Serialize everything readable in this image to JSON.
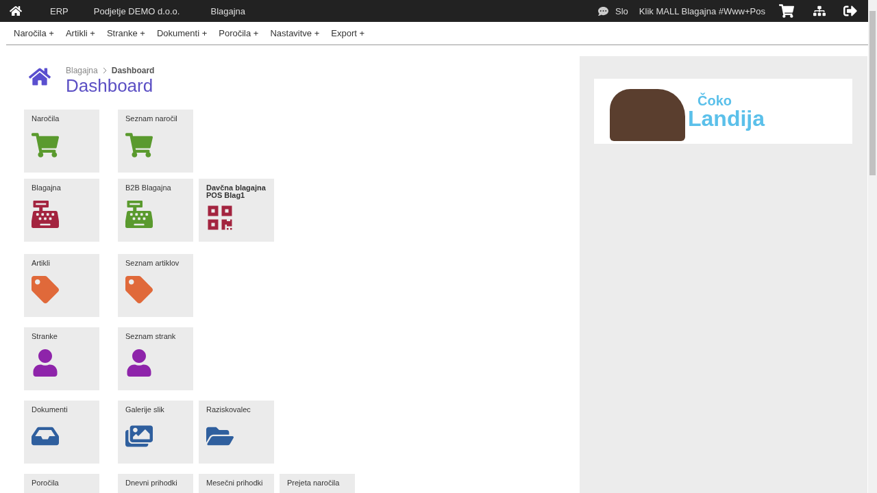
{
  "top_bar": {
    "items": [
      "ERP",
      "Podjetje DEMO d.o.o.",
      "Blagajna"
    ],
    "language": "Slo",
    "store": "Klik MALL Blagajna #Www+Pos"
  },
  "menu": [
    "Naročila +",
    "Artikli +",
    "Stranke +",
    "Dokumenti +",
    "Poročila +",
    "Nastavitve +",
    "Export +"
  ],
  "breadcrumb": {
    "parent": "Blagajna",
    "current": "Dashboard"
  },
  "title": "Dashboard",
  "groups": [
    {
      "rows": [
        [
          {
            "label": "Naročila",
            "kind": "cart",
            "color": "#5a9a2e",
            "bold": false
          },
          {
            "label": "Seznam naročil",
            "kind": "cart",
            "color": "#5a9a2e",
            "bold": false
          }
        ],
        [
          {
            "label": "Blagajna",
            "kind": "register",
            "color": "#a3243f",
            "bold": false
          },
          {
            "label": "B2B Blagajna",
            "kind": "register",
            "color": "#5a9a2e",
            "bold": false
          },
          {
            "label": "Davčna blagajna POS Blag1",
            "kind": "qr",
            "color": "#a3243f",
            "bold": true
          }
        ]
      ]
    },
    {
      "rows": [
        [
          {
            "label": "Artikli",
            "kind": "tag",
            "color": "#e0693a",
            "bold": false
          },
          {
            "label": "Seznam artiklov",
            "kind": "tag",
            "color": "#e0693a",
            "bold": false
          }
        ],
        [
          {
            "label": "Stranke",
            "kind": "person",
            "color": "#8e24aa",
            "bold": false
          },
          {
            "label": "Seznam strank",
            "kind": "person",
            "color": "#8e24aa",
            "bold": false
          }
        ],
        [
          {
            "label": "Dokumenti",
            "kind": "drawer",
            "color": "#2f5f9e",
            "bold": false
          },
          {
            "label": "Galerije slik",
            "kind": "gallery",
            "color": "#2f5f9e",
            "bold": false
          },
          {
            "label": "Raziskovalec",
            "kind": "folders",
            "color": "#2f5f9e",
            "bold": false
          }
        ],
        [
          {
            "label": "Poročila",
            "bold": false
          },
          {
            "label": "Dnevni prihodki",
            "bold": false
          },
          {
            "label": "Mesečni prihodki",
            "bold": false
          },
          {
            "label": "Prejeta naročila",
            "bold": false
          }
        ]
      ]
    }
  ],
  "banner": {
    "line1": "Čoko",
    "line2": "Landija"
  }
}
